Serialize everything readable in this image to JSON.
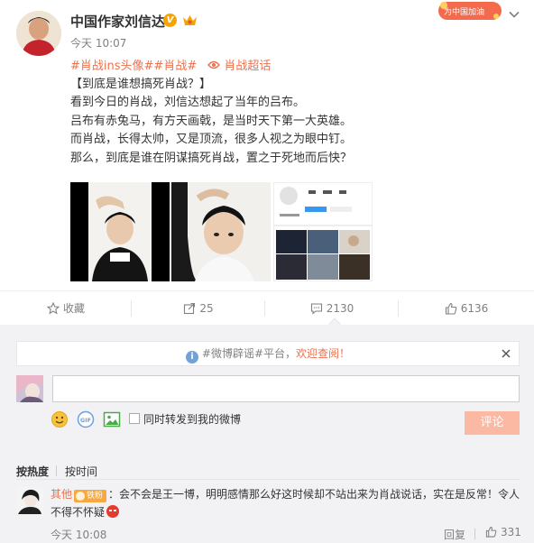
{
  "post": {
    "author": "中国作家刘信达",
    "verified_mark": "V",
    "time": "今天 10:07",
    "event_banner": "为中国加油",
    "tags": [
      "#肖战ins头像#",
      "#肖战#",
      "肖战超话"
    ],
    "lines": [
      "【到底是谁想搞死肖战？】",
      "看到今日的肖战，刘信达想起了当年的吕布。",
      "吕布有赤兔马，有方天画戟，是当时天下第一大英雄。",
      "而肖战，长得太帅，又是顶流，很多人视之为眼中钉。",
      "那么，到底是谁在阴谋搞死肖战，置之于死地而后快？"
    ]
  },
  "actions": {
    "favorite": "收藏",
    "repost_count": "25",
    "comment_count": "2130",
    "like_count": "6136"
  },
  "notice": {
    "prefix": "#微博辟谣#平台，",
    "highlight": "欢迎查阅！"
  },
  "composer": {
    "input_value": "",
    "repost_label": "同时转发到我的微博",
    "submit_label": "评论"
  },
  "sort": {
    "hot": "按热度",
    "time": "按时间"
  },
  "comment": {
    "user": "其他",
    "fan_badge": "铁粉",
    "text": "：会不会是王一博，明明感情那么好这时候却不站出来为肖战说话，实在是反常！令人不得不怀疑",
    "time": "今天 10:08",
    "reply_label": "回复",
    "likes": "331"
  },
  "colors": {
    "accent": "#eb7350",
    "verified": "#f7a400",
    "submit_disabled": "#fbb9a3",
    "comment_bg": "#f2f2f5"
  },
  "icons": [
    "collapse-chevron-icon",
    "super-topic-icon",
    "favorite-star-icon",
    "repost-icon",
    "comment-icon",
    "like-icon",
    "info-icon",
    "close-icon",
    "emoji-icon",
    "gif-icon",
    "image-icon",
    "angry-emoji-icon"
  ]
}
